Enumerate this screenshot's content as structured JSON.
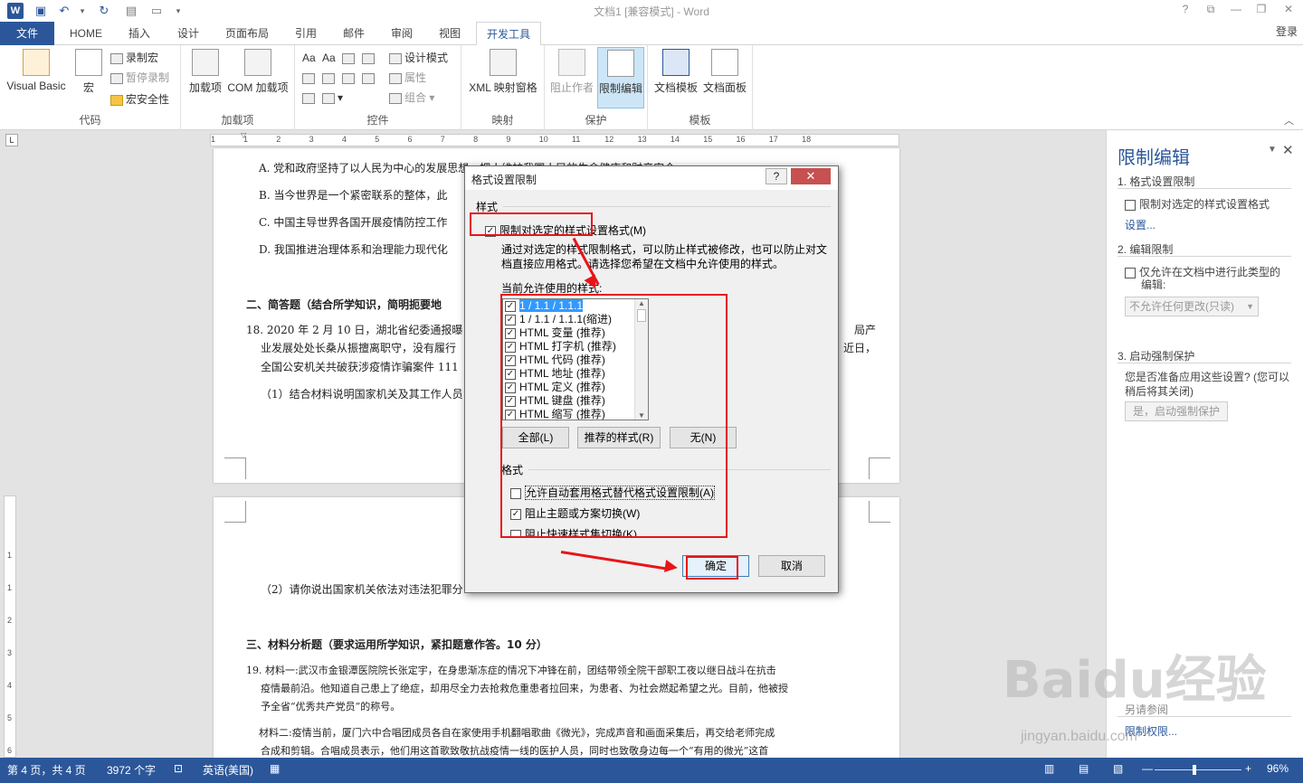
{
  "window": {
    "title": "文档1 [兼容模式] - Word",
    "help": "?",
    "login": "登录"
  },
  "tabs": [
    "文件",
    "HOME",
    "插入",
    "设计",
    "页面布局",
    "引用",
    "邮件",
    "审阅",
    "视图",
    "开发工具"
  ],
  "ribbon": {
    "groups": {
      "code": "代码",
      "addins": "加载项",
      "controls": "控件",
      "mapping": "映射",
      "protect": "保护",
      "templates": "模板"
    },
    "visual_basic": "Visual Basic",
    "macro": "宏",
    "record_macro": "录制宏",
    "pause_record": "暂停录制",
    "macro_security": "宏安全性",
    "addins": "加载项",
    "com_addins": "COM 加载项",
    "design_mode": "设计模式",
    "properties": "属性",
    "group": "组合",
    "xml_pane": "XML 映射窗格",
    "block_authors": "阻止作者",
    "restrict_editing": "限制编辑",
    "doc_template": "文档模板",
    "doc_panel": "文档面板"
  },
  "ruler_numbers": [
    "1",
    "1",
    "2",
    "3",
    "4",
    "5",
    "6",
    "7",
    "8",
    "9",
    "10",
    "11",
    "12",
    "13",
    "14",
    "15",
    "16",
    "17",
    "18"
  ],
  "vruler_numbers": [
    "1",
    "1",
    "2",
    "3",
    "4",
    "5",
    "6"
  ],
  "document": {
    "lines": [
      "A. 党和政府坚持了以人民为中心的发展思想，把人维护我国人民的生命健康和财产安全",
      "B. 当今世界是一个紧密联系的整体，此",
      "C. 中国主导世界各国开展疫情防控工作",
      "D. 我国推进治理体系和治理能力现代化",
      "二、简答题（结合所学知识，简明扼要地",
      "18. 2020 年 2 月 10 日，湖北省纪委通报曝",
      "业发展处处长桑从振擅离职守，没有履行",
      "全国公安机关共破获涉疫情诈骗案件 111",
      "（1）结合材料说明国家机关及其工作人员",
      "（2）请你说出国家机关依法对违法犯罪分",
      "三、材料分析题（要求运用所学知识，紧扣题意作答。10 分）",
      "19. 材料一:武汉市金银潭医院院长张定宇，在身患渐冻症的情况下冲锋在前，团结带领全院干部职工夜以继日战斗在抗击",
      "疫情最前沿。他知道自己患上了绝症，却用尽全力去抢救危重患者拉回来，为患者、为社会燃起希望之光。目前，他被授",
      "予全省“优秀共产党员”的称号。",
      "材料二:疫情当前，厦门六中合唱团成员各自在家使用手机翻唱歌曲《微光》，完成声音和画面采集后，再交给老师完成",
      "合成和剪辑。合唱成员表示，他们用这首歌致敬抗战疫情一线的医护人员，同时也致敬身边每一个“有用的微光”这首"
    ],
    "right_fragments": [
      "局产",
      "近日，"
    ]
  },
  "dialog": {
    "title": "格式设置限制",
    "help": "?",
    "close": "✕",
    "styles_section": "样式",
    "limit_checkbox": "限制对选定的样式设置格式(M)",
    "description_1": "通过对选定的样式限制格式，可以防止样式被修改，也可以防止对文",
    "description_2": "档直接应用格式。请选择您希望在文档中允许使用的样式。",
    "allowed_label": "当前允许使用的样式:",
    "style_items": [
      "1 / 1.1 / 1.1.1",
      "1 / 1.1 / 1.1.1(缩进)",
      "HTML 变量 (推荐)",
      "HTML 打字机 (推荐)",
      "HTML 代码 (推荐)",
      "HTML 地址 (推荐)",
      "HTML 定义 (推荐)",
      "HTML 键盘 (推荐)",
      "HTML 缩写 (推荐)"
    ],
    "btn_all": "全部(L)",
    "btn_recommended": "推荐的样式(R)",
    "btn_none": "无(N)",
    "format_section": "格式",
    "opt_autoformat": "允许自动套用格式替代格式设置限制(A)",
    "opt_block_theme": "阻止主题或方案切换(W)",
    "opt_block_quickstyle": "阻止快速样式集切换(K)",
    "ok": "确定",
    "cancel": "取消"
  },
  "pane": {
    "title": "限制编辑",
    "s1": "1. 格式设置限制",
    "s1_check": "限制对选定的样式设置格式",
    "s1_link": "设置...",
    "s2": "2. 编辑限制",
    "s2_check_1": "仅允许在文档中进行此类型的",
    "s2_check_2": "编辑:",
    "s2_select": "不允许任何更改(只读)",
    "s3": "3. 启动强制保护",
    "s3_q1": "您是否准备应用这些设置? (您可以",
    "s3_q2": "稍后将其关闭)",
    "s3_btn": "是，启动强制保护",
    "footer_label": "另请参阅",
    "footer_link": "限制权限..."
  },
  "status": {
    "page": "第 4 页，共 4 页",
    "words": "3972 个字",
    "lang": "英语(美国)",
    "zoom": "96%"
  },
  "watermark": {
    "logo": "Baidu经验",
    "url": "jingyan.baidu.com"
  },
  "colors": {
    "word_blue": "#2b579a",
    "annotation_red": "#e8141a"
  }
}
